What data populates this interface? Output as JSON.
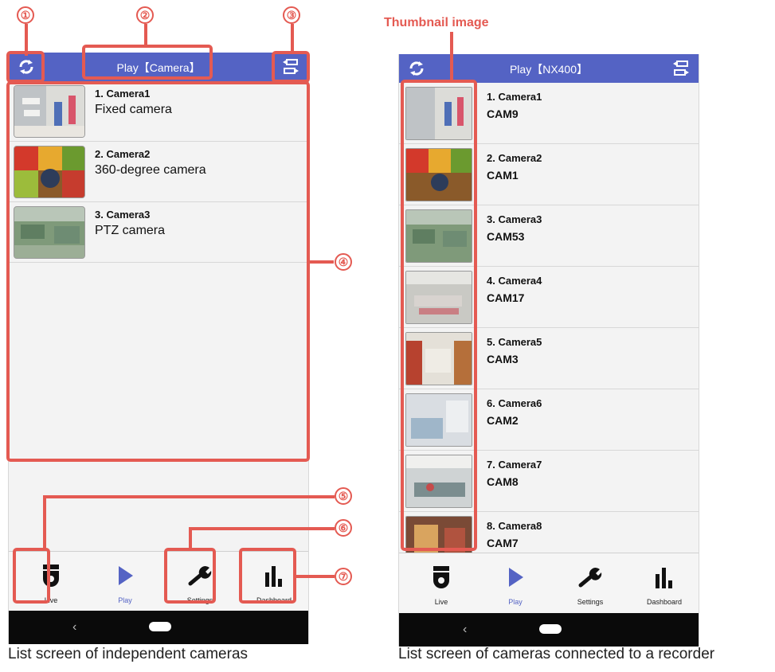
{
  "left_phone": {
    "title": "Play【Camera】",
    "rows": [
      {
        "name": "1. Camera1",
        "sub": "Fixed camera"
      },
      {
        "name": "2. Camera2",
        "sub": "360-degree camera"
      },
      {
        "name": "3. Camera3",
        "sub": "PTZ camera"
      }
    ],
    "nav": [
      "Live",
      "Play",
      "Settings",
      "Dashboard"
    ],
    "back_glyph": "‹"
  },
  "right_phone": {
    "title": "Play【NX400】",
    "rows": [
      {
        "name": "1. Camera1",
        "sub": "CAM9"
      },
      {
        "name": "2. Camera2",
        "sub": "CAM1"
      },
      {
        "name": "3. Camera3",
        "sub": "CAM53"
      },
      {
        "name": "4. Camera4",
        "sub": "CAM17"
      },
      {
        "name": "5. Camera5",
        "sub": "CAM3"
      },
      {
        "name": "6. Camera6",
        "sub": "CAM2"
      },
      {
        "name": "7. Camera7",
        "sub": "CAM8"
      },
      {
        "name": "8. Camera8",
        "sub": "CAM7"
      }
    ],
    "nav": [
      "Live",
      "Play",
      "Settings",
      "Dashboard"
    ],
    "back_glyph": "‹"
  },
  "callouts": {
    "n1": "①",
    "n2": "②",
    "n3": "③",
    "n4": "④",
    "n5": "⑤",
    "n6": "⑥",
    "n7": "⑦",
    "thumbnail_label": "Thumbnail image"
  },
  "captions": {
    "left": "List screen of independent cameras",
    "right": "List screen of cameras connected to a recorder"
  },
  "colors": {
    "accent": "#5463c4",
    "callout": "#e45a52"
  },
  "icons": [
    "refresh-icon",
    "switch-icon",
    "camera-dome-icon",
    "play-icon",
    "wrench-icon",
    "bar-chart-icon"
  ]
}
